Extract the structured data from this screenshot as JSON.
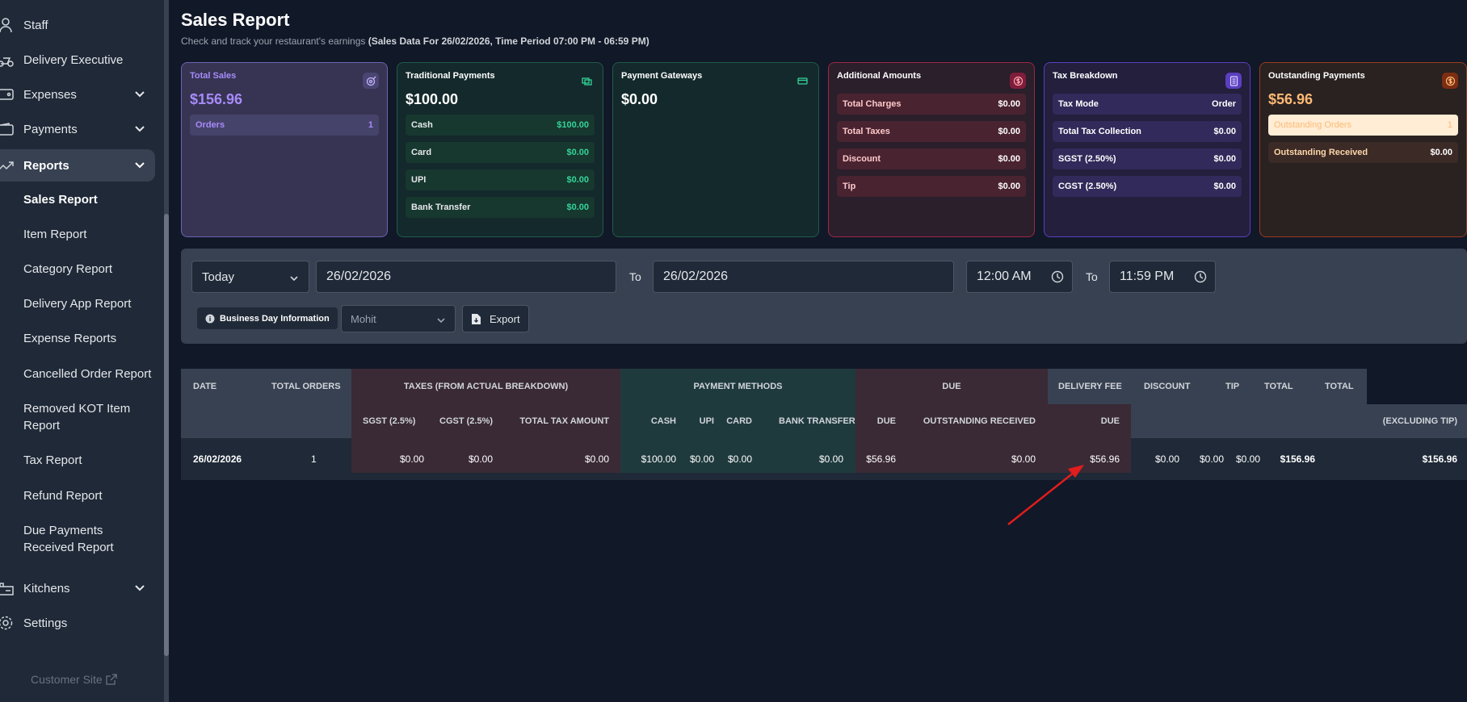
{
  "sidebar": {
    "items": [
      {
        "label": "Staff",
        "icon": "staff-icon"
      },
      {
        "label": "Delivery Executive",
        "icon": "delivery-executive-icon"
      },
      {
        "label": "Expenses",
        "icon": "expenses-icon"
      },
      {
        "label": "Payments",
        "icon": "payments-icon"
      },
      {
        "label": "Reports",
        "icon": "reports-icon"
      },
      {
        "label": "Kitchens",
        "icon": "kitchens-icon"
      },
      {
        "label": "Settings",
        "icon": "settings-icon"
      }
    ],
    "report_subitems": [
      "Sales Report",
      "Item Report",
      "Category Report",
      "Delivery App Report",
      "Expense Reports",
      "Cancelled Order Report",
      "Removed KOT Item Report",
      "Tax Report",
      "Refund Report",
      "Due Payments Received Report"
    ],
    "customer_site": "Customer Site"
  },
  "header": {
    "title": "Sales Report",
    "subtitle": "Check and track your restaurant's earnings",
    "subtitle_bold": "(Sales Data For 26/02/2026, Time Period 07:00 PM - 06:59 PM)"
  },
  "cards": {
    "total_sales": {
      "title": "Total Sales",
      "amount": "$156.96",
      "rows": [
        {
          "label": "Orders",
          "value": "1"
        }
      ]
    },
    "traditional": {
      "title": "Traditional Payments",
      "amount": "$100.00",
      "rows": [
        {
          "label": "Cash",
          "value": "$100.00"
        },
        {
          "label": "Card",
          "value": "$0.00"
        },
        {
          "label": "UPI",
          "value": "$0.00"
        },
        {
          "label": "Bank Transfer",
          "value": "$0.00"
        }
      ]
    },
    "gateways": {
      "title": "Payment Gateways",
      "amount": "$0.00"
    },
    "additional": {
      "title": "Additional Amounts",
      "rows": [
        {
          "label": "Total Charges",
          "value": "$0.00"
        },
        {
          "label": "Total Taxes",
          "value": "$0.00"
        },
        {
          "label": "Discount",
          "value": "$0.00"
        },
        {
          "label": "Tip",
          "value": "$0.00"
        }
      ]
    },
    "tax": {
      "title": "Tax Breakdown",
      "rows": [
        {
          "label": "Tax Mode",
          "value": "Order"
        },
        {
          "label": "Total Tax Collection",
          "value": "$0.00"
        },
        {
          "label": "SGST (2.50%)",
          "value": "$0.00"
        },
        {
          "label": "CGST (2.50%)",
          "value": "$0.00"
        }
      ]
    },
    "outstanding": {
      "title": "Outstanding Payments",
      "amount": "$56.96",
      "rows": [
        {
          "label": "Outstanding Orders",
          "value": "1"
        },
        {
          "label": "Outstanding Received",
          "value": "$0.00"
        }
      ]
    }
  },
  "filters": {
    "range": "Today",
    "from_date": "26/02/2026",
    "to_label": "To",
    "to_date": "26/02/2026",
    "from_time": "12:00 AM",
    "to_time": "11:59 PM",
    "business_day_btn": "Business Day Information",
    "staff": "Mohit",
    "export": "Export"
  },
  "table": {
    "headers": {
      "date": "DATE",
      "total_orders": "TOTAL ORDERS",
      "taxes": "TAXES (FROM ACTUAL BREAKDOWN)",
      "payment_methods": "PAYMENT METHODS",
      "due": "DUE",
      "delivery_fee": "DELIVERY FEE",
      "discount": "DISCOUNT",
      "tip": "TIP",
      "total": "TOTAL",
      "total2": "TOTAL",
      "sgst": "SGST (2.5%)",
      "cgst": "CGST (2.5%)",
      "total_tax": "TOTAL TAX AMOUNT",
      "cash": "CASH",
      "upi": "UPI",
      "card": "CARD",
      "bank_transfer": "BANK TRANSFER",
      "due_sub": "DUE",
      "outstanding_received": "OUTSTANDING RECEIVED",
      "due_sub2": "DUE",
      "excluding_tip": "(EXCLUDING TIP)"
    },
    "row": {
      "date": "26/02/2026",
      "total_orders": "1",
      "sgst": "$0.00",
      "cgst": "$0.00",
      "total_tax": "$0.00",
      "cash": "$100.00",
      "upi": "$0.00",
      "card": "$0.00",
      "bank_transfer": "$0.00",
      "due": "$56.96",
      "outstanding_received": "$0.00",
      "due2": "$56.96",
      "delivery_fee": "$0.00",
      "discount": "$0.00",
      "tip": "$0.00",
      "total": "$156.96",
      "total_excl_tip": "$156.96"
    }
  },
  "colors": {
    "annotation_arrow": "#e11d1d"
  }
}
